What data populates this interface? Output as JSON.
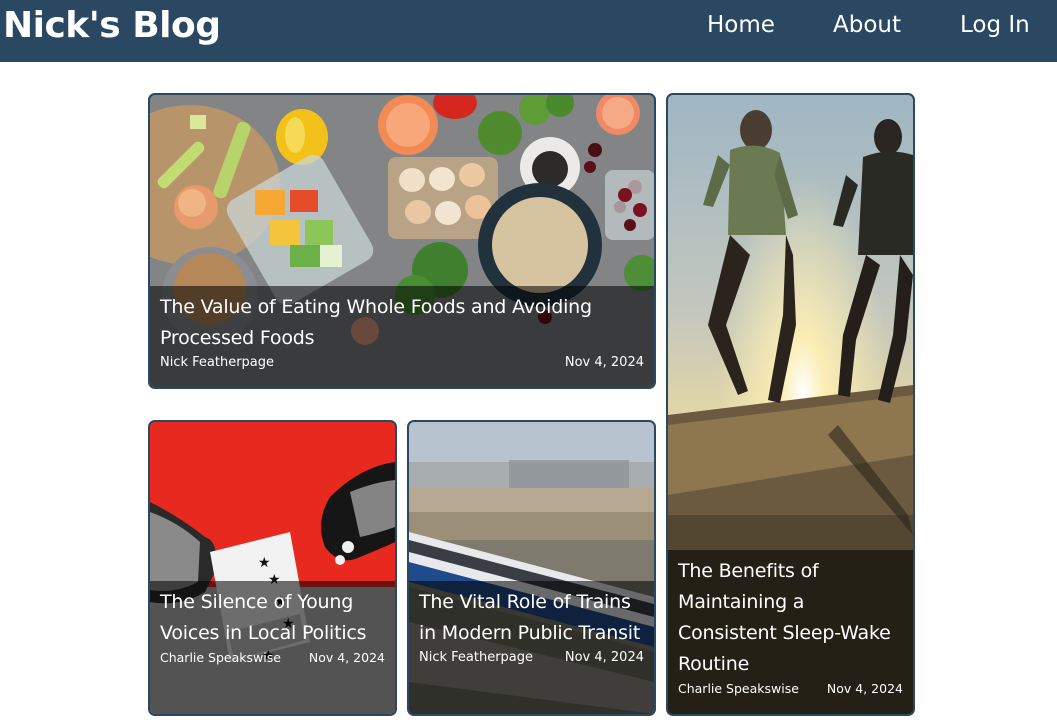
{
  "header": {
    "brand": "Nick's Blog",
    "nav": [
      {
        "label": "Home"
      },
      {
        "label": "About"
      },
      {
        "label": "Log In"
      }
    ]
  },
  "posts": [
    {
      "title": "The Value of Eating Whole Foods and Avoiding Processed Foods",
      "author": "Nick Featherpage",
      "date": "Nov 4, 2024",
      "image": "whole-foods-photo"
    },
    {
      "title": "The Benefits of Maintaining a Consistent Sleep-Wake Routine",
      "author": "Charlie Speakswise",
      "date": "Nov 4, 2024",
      "image": "sunrise-runners-photo"
    },
    {
      "title": "The Silence of Young Voices in Local Politics",
      "author": "Charlie Speakswise",
      "date": "Nov 4, 2024",
      "image": "ballot-hand-illustration"
    },
    {
      "title": "The Vital Role of Trains in Modern Public Transit",
      "author": "Nick Featherpage",
      "date": "Nov 4, 2024",
      "image": "high-speed-train-photo"
    }
  ],
  "colors": {
    "header_bg": "#2b4862",
    "card_border": "#2b4862",
    "overlay": "rgba(0,0,0,0.55)"
  }
}
